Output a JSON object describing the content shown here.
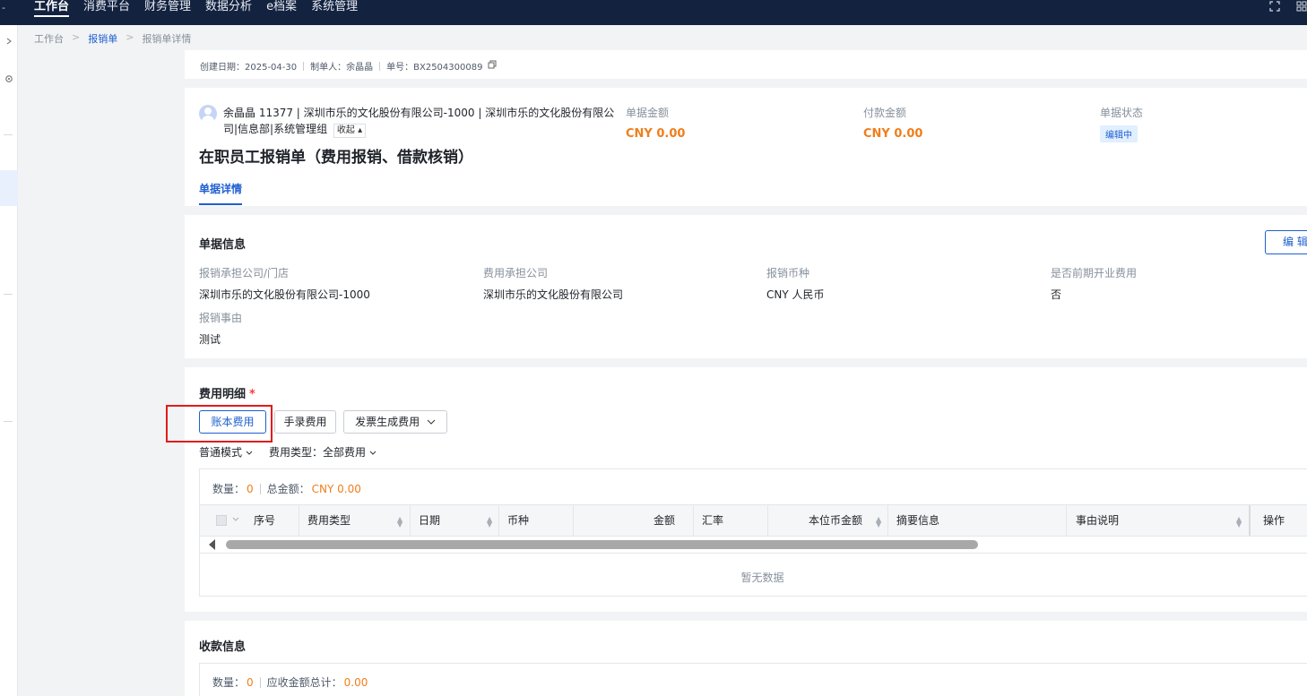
{
  "topnav": {
    "left_glyph": "-",
    "items": [
      "工作台",
      "消费平台",
      "财务管理",
      "数据分析",
      "e档案",
      "系统管理"
    ],
    "active_index": 0
  },
  "breadcrumb": {
    "items": [
      "工作台",
      "报销单",
      "报销单详情"
    ],
    "separator": ">"
  },
  "meta": {
    "created": "创建日期：2025-04-30",
    "creator": "制单人：余晶晶",
    "doc_no": "单号：BX2504300089"
  },
  "header": {
    "org_text": "余晶晶 11377 | 深圳市乐的文化股份有限公司-1000 | 深圳市乐的文化股份有限公司|信息部|系统管理组",
    "collapse_label": "收起",
    "title": "在职员工报销单（费用报销、借款核销）",
    "tab_label": "单据详情",
    "doc_amount_label": "单据金额",
    "doc_amount_value": "CNY 0.00",
    "pay_amount_label": "付款金额",
    "pay_amount_value": "CNY 0.00",
    "status_label": "单据状态",
    "status_value": "编辑中"
  },
  "info": {
    "title": "单据信息",
    "edit_label": "编 辑",
    "fields": [
      {
        "label": "报销承担公司/门店",
        "value": "深圳市乐的文化股份有限公司-1000"
      },
      {
        "label": "费用承担公司",
        "value": "深圳市乐的文化股份有限公司"
      },
      {
        "label": "报销币种",
        "value": "CNY 人民币"
      },
      {
        "label": "是否前期开业费用",
        "value": "否"
      },
      {
        "label": "报销事由",
        "value": "测试"
      }
    ]
  },
  "expense": {
    "title": "费用明细",
    "required_mark": "*",
    "buttons": {
      "ledger": "账本费用",
      "manual": "手录费用",
      "invoice": "发票生成费用"
    },
    "mode_filter": "普通模式",
    "type_filter": "费用类型：全部费用",
    "stats": {
      "count_label": "数量：",
      "count_value": "0",
      "total_label": "总金额：",
      "total_value": "CNY 0.00"
    },
    "columns": [
      "序号",
      "费用类型",
      "日期",
      "币种",
      "金额",
      "汇率",
      "本位币金额",
      "摘要信息",
      "事由说明",
      "操作"
    ],
    "empty_text": "暂无数据"
  },
  "receipt": {
    "title": "收款信息",
    "count_label": "数量：",
    "count_value": "0",
    "total_label": "应收金额总计：",
    "total_value": "0.00"
  },
  "colors": {
    "nav_bg": "#13223f",
    "accent": "#1f5fd1",
    "amount": "#f07e1b",
    "highlight": "#e01b1b"
  }
}
